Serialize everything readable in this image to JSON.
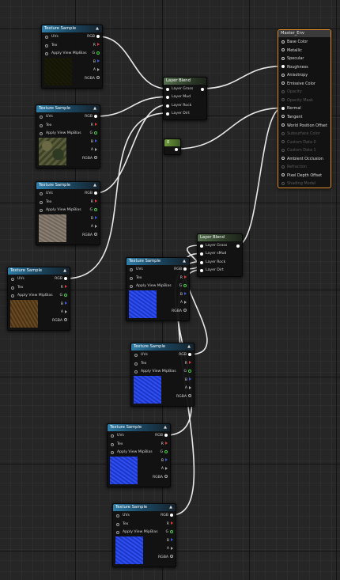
{
  "texture_node": {
    "title": "Texture Sample",
    "inputs": [
      "UVs",
      "Tex",
      "Apply View MipBias"
    ],
    "outputs": [
      "RGB",
      "R",
      "G",
      "B",
      "A",
      "RGBA"
    ]
  },
  "layer_blend": {
    "title": "Layer Blend",
    "inputs_top": [
      "Layer Grass",
      "Layer Mud",
      "Layer Rock",
      "Layer Dirt"
    ],
    "inputs_bottom": [
      "Layer Grass",
      "Layer sMud",
      "Layer Rock",
      "Layer Dirt"
    ]
  },
  "constant_node": {
    "value": "0"
  },
  "master": {
    "title": "Master_Env",
    "pins": [
      {
        "label": "Base Color",
        "enabled": true,
        "connected": false
      },
      {
        "label": "Metallic",
        "enabled": true,
        "connected": false
      },
      {
        "label": "Specular",
        "enabled": true,
        "connected": false
      },
      {
        "label": "Roughness",
        "enabled": true,
        "connected": true
      },
      {
        "label": "Anisotropy",
        "enabled": true,
        "connected": false
      },
      {
        "label": "Emissive Color",
        "enabled": true,
        "connected": false
      },
      {
        "label": "Opacity",
        "enabled": false,
        "connected": false
      },
      {
        "label": "Opacity Mask",
        "enabled": false,
        "connected": false
      },
      {
        "label": "Normal",
        "enabled": true,
        "connected": true
      },
      {
        "label": "Tangent",
        "enabled": true,
        "connected": false
      },
      {
        "label": "World Position Offset",
        "enabled": true,
        "connected": false
      },
      {
        "label": "Subsurface Color",
        "enabled": false,
        "connected": false
      },
      {
        "label": "Custom Data 0",
        "enabled": false,
        "connected": false
      },
      {
        "label": "Custom Data 1",
        "enabled": false,
        "connected": false
      },
      {
        "label": "Ambient Occlusion",
        "enabled": true,
        "connected": false
      },
      {
        "label": "Refraction",
        "enabled": false,
        "connected": false
      },
      {
        "label": "Pixel Depth Offset",
        "enabled": true,
        "connected": false
      },
      {
        "label": "Shading Model",
        "enabled": false,
        "connected": false
      }
    ]
  },
  "colors": {
    "wire": "#e8e8e8",
    "texture_header": "#2f7ea8",
    "blend_header": "#55704e",
    "constant_header": "#6e9a3b",
    "master_border": "#e0902a",
    "pin_r": "#e03a3a",
    "pin_g": "#4cd04c",
    "pin_b": "#3a5be0"
  },
  "thumbnails": [
    "grass-texture",
    "mud-texture",
    "rock-texture",
    "dirt-texture",
    "normal-map",
    "normal-map",
    "normal-map",
    "normal-map"
  ]
}
